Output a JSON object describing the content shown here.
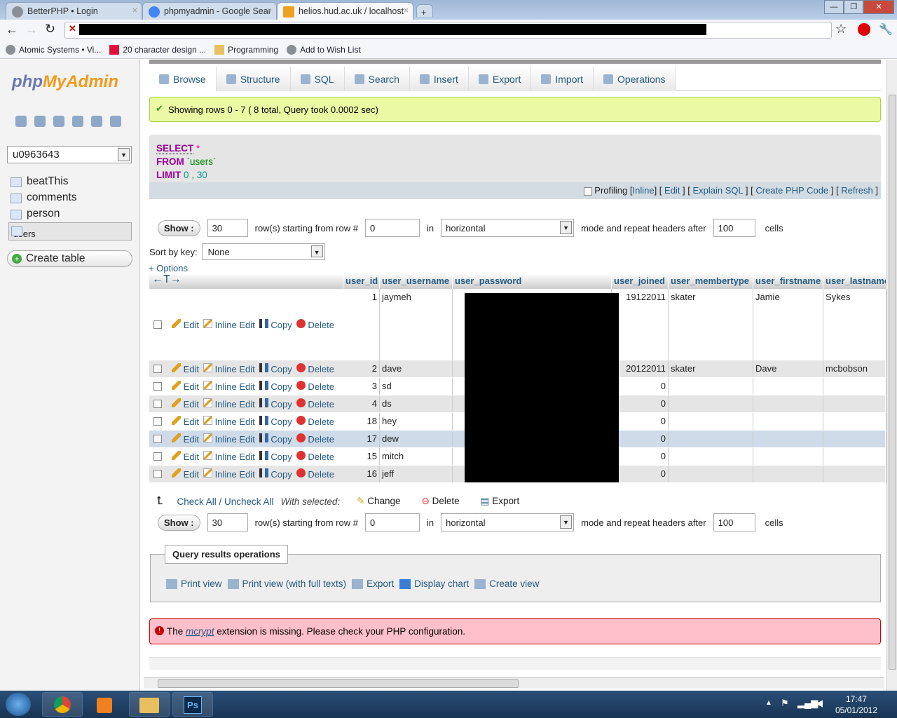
{
  "browser": {
    "tabs": [
      {
        "label": "BetterPHP • Login",
        "active": false
      },
      {
        "label": "phpmyadmin - Google Sear",
        "active": false
      },
      {
        "label": "helios.hud.ac.uk / localhost",
        "active": true
      }
    ],
    "bookmarks": [
      "Atomic Systems • Vi...",
      "20 character design ...",
      "Programming",
      "Add to Wish List"
    ]
  },
  "sidebar": {
    "logo_php": "php",
    "logo_my": "MyAdmin",
    "database": "u0963643",
    "tables": [
      "beatThis",
      "comments",
      "person",
      "users"
    ],
    "selected_table": "users",
    "create_table": "Create table"
  },
  "tabs": [
    {
      "label": "Browse",
      "active": true
    },
    {
      "label": "Structure"
    },
    {
      "label": "SQL"
    },
    {
      "label": "Search"
    },
    {
      "label": "Insert"
    },
    {
      "label": "Export"
    },
    {
      "label": "Import"
    },
    {
      "label": "Operations"
    }
  ],
  "success_message": "Showing rows 0 - 7 ( 8 total, Query took 0.0002 sec)",
  "sql": {
    "select": "SELECT",
    "star": "*",
    "from": "FROM",
    "table": "`users`",
    "limit": "LIMIT",
    "limit_vals": "0 , 30"
  },
  "sql_footer": {
    "profiling": "Profiling",
    "inline": "Inline",
    "edit": "Edit",
    "explain": "Explain SQL",
    "php": "Create PHP Code",
    "refresh": "Refresh"
  },
  "nav": {
    "show": "Show :",
    "rows": "30",
    "rows_label": "row(s) starting from row #",
    "start": "0",
    "in": "in",
    "mode": "horizontal",
    "repeat_label": "mode and repeat headers after",
    "repeat": "100",
    "cells": "cells"
  },
  "sort": {
    "label": "Sort by key:",
    "value": "None"
  },
  "options": "+ Options",
  "columns": [
    "user_id",
    "user_username",
    "user_password",
    "user_joined",
    "user_membertype",
    "user_firstname",
    "user_lastname"
  ],
  "actions": {
    "edit": "Edit",
    "inline_edit": "Inline Edit",
    "copy": "Copy",
    "delete": "Delete"
  },
  "rows": [
    {
      "user_id": "1",
      "user_username": "jaymeh",
      "user_joined": "19122011",
      "user_membertype": "skater",
      "user_firstname": "Jamie",
      "user_lastname": "Sykes"
    },
    {
      "user_id": "2",
      "user_username": "dave",
      "user_joined": "20122011",
      "user_membertype": "skater",
      "user_firstname": "Dave",
      "user_lastname": "mcbobson"
    },
    {
      "user_id": "3",
      "user_username": "sd",
      "user_joined": "0",
      "user_membertype": "",
      "user_firstname": "",
      "user_lastname": ""
    },
    {
      "user_id": "4",
      "user_username": "ds",
      "user_joined": "0",
      "user_membertype": "",
      "user_firstname": "",
      "user_lastname": ""
    },
    {
      "user_id": "18",
      "user_username": "hey",
      "user_joined": "0",
      "user_membertype": "",
      "user_firstname": "",
      "user_lastname": ""
    },
    {
      "user_id": "17",
      "user_username": "dew",
      "user_joined": "0",
      "user_membertype": "",
      "user_firstname": "",
      "user_lastname": ""
    },
    {
      "user_id": "15",
      "user_username": "mitch",
      "user_joined": "0",
      "user_membertype": "",
      "user_firstname": "",
      "user_lastname": ""
    },
    {
      "user_id": "16",
      "user_username": "jeff",
      "user_joined": "0",
      "user_membertype": "",
      "user_firstname": "",
      "user_lastname": ""
    }
  ],
  "with_selected": {
    "check_all": "Check All / Uncheck All",
    "label": "With selected:",
    "change": "Change",
    "delete": "Delete",
    "export": "Export"
  },
  "query_ops": {
    "title": "Query results operations",
    "links": [
      "Print view",
      "Print view (with full texts)",
      "Export",
      "Display chart",
      "Create view"
    ]
  },
  "error": {
    "pre": "The",
    "link": "mcrypt",
    "post": "extension is missing. Please check your PHP configuration."
  },
  "taskbar": {
    "time": "17:47",
    "date": "05/01/2012"
  }
}
